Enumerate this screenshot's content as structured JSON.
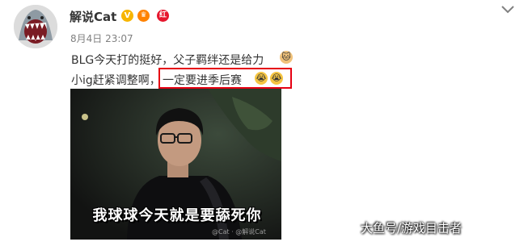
{
  "post": {
    "username": "解说Cat",
    "timestamp": "8月4日 23:07",
    "line1": "BLG今天打的挺好，父子羁绊还是给力",
    "line2_prefix": "小ig赶紧调整啊，",
    "line2_highlight": "一定要进季后赛",
    "badges": {
      "crown": "♛",
      "red": "红"
    }
  },
  "image": {
    "caption": "我球球今天就是要舔死你",
    "inner_watermark": "@Cat · @解说Cat"
  },
  "site_watermark": "大鱼号/游戏目击者",
  "icons": {
    "avatar": "shark-avatar-icon",
    "verified": "verified-v-icon",
    "menu": "chevron-down-icon",
    "emoji_cat": "cat-face-emoji-icon",
    "emoji_cry": "crying-face-emoji-icon"
  },
  "colors": {
    "highlight_border": "#e60012",
    "verified": "#f7b500",
    "timestamp": "#808080"
  }
}
